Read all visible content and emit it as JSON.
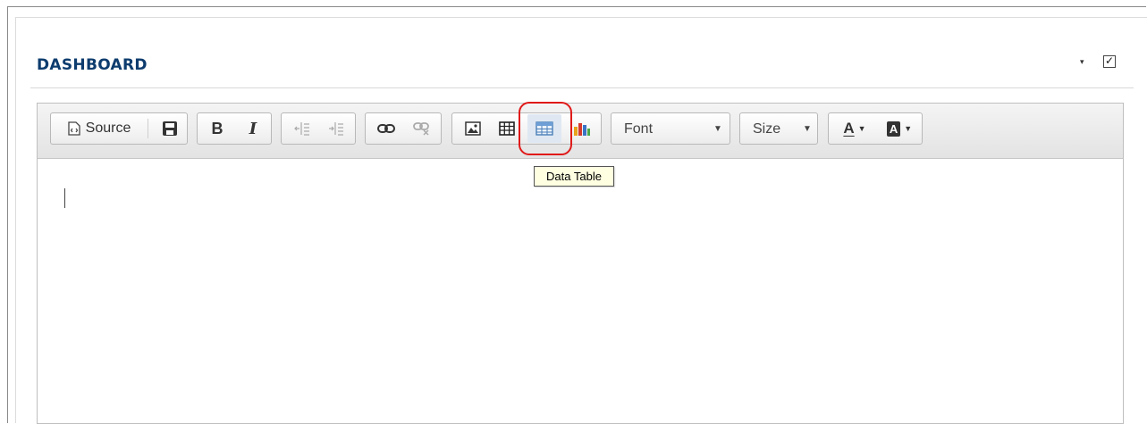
{
  "panel": {
    "title": "DASHBOARD",
    "options_caret": "▾",
    "checkbox_checked": true
  },
  "toolbar": {
    "source_label": "Source",
    "bold_label": "B",
    "italic_label": "I",
    "font_combo": {
      "label": "Font"
    },
    "size_combo": {
      "label": "Size"
    },
    "text_color_label": "A",
    "bg_color_label": "A",
    "highlight_color": "#e01919"
  },
  "tooltip": {
    "text": "Data Table"
  }
}
